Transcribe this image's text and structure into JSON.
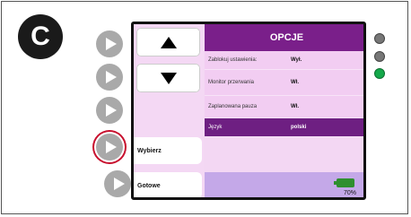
{
  "badge": "C",
  "screen": {
    "header_title": "OPCJE",
    "buttons": {
      "select_label": "Wybierz",
      "done_label": "Gotowe"
    },
    "settings": [
      {
        "label": "Zablokuj ustawienia:",
        "value": "Wył."
      },
      {
        "label": "Monitor przerwania",
        "value": "Wł."
      },
      {
        "label": "Zaplanowana pauza",
        "value": "Wł."
      },
      {
        "label": "Język",
        "value": "polski"
      }
    ],
    "battery_percent": "70%"
  },
  "colors": {
    "header": "#7a1f8a",
    "selected_row": "#6e1f82",
    "status_green": "#14a84a",
    "ring_red": "#c8102e"
  },
  "icons": [
    "up-arrow-icon",
    "down-arrow-icon",
    "play-icon",
    "battery-icon"
  ]
}
